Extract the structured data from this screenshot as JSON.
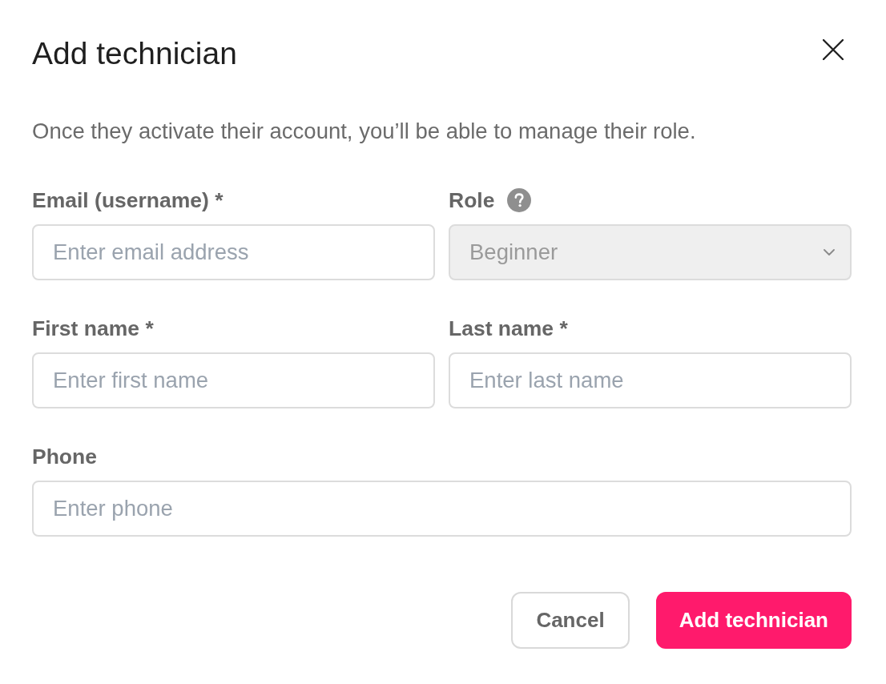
{
  "dialog": {
    "title": "Add technician",
    "description": "Once they activate their account, you’ll be able to manage their role."
  },
  "fields": [
    {
      "kind": "text",
      "label": "Email (username) *",
      "placeholder": "Enter email address",
      "help": false,
      "disabled": false
    },
    {
      "kind": "select",
      "label": "Role",
      "value": "Beginner",
      "help": true,
      "disabled": true
    },
    {
      "kind": "text",
      "label": "First name *",
      "placeholder": "Enter first name",
      "help": false,
      "disabled": false
    },
    {
      "kind": "text",
      "label": "Last name *",
      "placeholder": "Enter last name",
      "help": false,
      "disabled": false
    },
    {
      "kind": "text",
      "label": "Phone",
      "placeholder": "Enter phone",
      "help": false,
      "disabled": false
    }
  ],
  "buttons": [
    {
      "label": "Cancel",
      "kind": "secondary"
    },
    {
      "label": "Add technician",
      "kind": "primary"
    }
  ]
}
